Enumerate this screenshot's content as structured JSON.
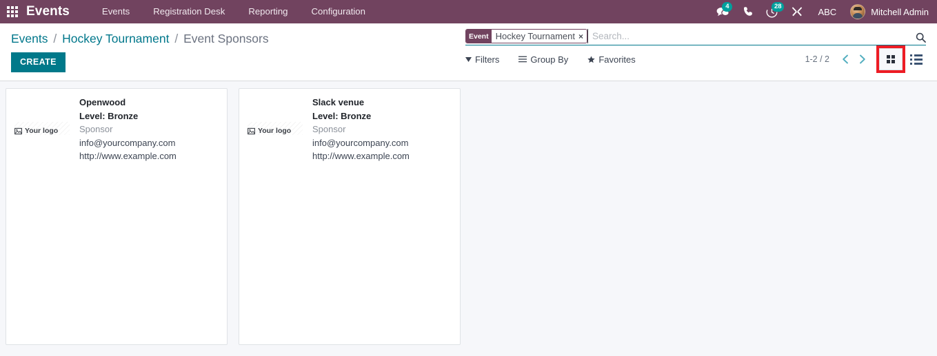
{
  "navbar": {
    "apps_icon": "apps-grid-icon",
    "brand": "Events",
    "menu": [
      {
        "label": "Events"
      },
      {
        "label": "Registration Desk"
      },
      {
        "label": "Reporting"
      },
      {
        "label": "Configuration"
      }
    ],
    "systray": {
      "messages_icon": "chat-bubble-icon",
      "messages_count": "4",
      "phone_icon": "phone-icon",
      "activities_icon": "clock-moon-icon",
      "activities_count": "28",
      "tools_icon": "wrench-icon",
      "debug_label": "ABC",
      "user_name": "Mitchell Admin",
      "avatar_icon": "avatar"
    },
    "colors": {
      "background": "#71435f",
      "badge": "#00a09d"
    }
  },
  "control_panel": {
    "breadcrumb": {
      "root": "Events",
      "parent": "Hockey Tournament",
      "separator": "/",
      "current": "Event Sponsors"
    },
    "create_label": "CREATE",
    "search": {
      "facet_label": "Event",
      "facet_value": "Hockey Tournament",
      "facet_remove_icon": "×",
      "placeholder": "Search...",
      "value": "",
      "magnifier_icon": "search-icon"
    },
    "filters": [
      {
        "label": "Filters",
        "icon": "filter-caret-icon"
      },
      {
        "label": "Group By",
        "icon": "bars-icon"
      },
      {
        "label": "Favorites",
        "icon": "star-icon"
      }
    ],
    "pager": {
      "range": "1-2 / 2",
      "previous_icon": "chevron-left-icon",
      "next_icon": "chevron-right-icon"
    },
    "views": [
      {
        "name": "kanban",
        "icon": "kanban-icon",
        "active": true,
        "highlight_color": "#ed1c24"
      },
      {
        "name": "list",
        "icon": "list-icon",
        "active": false
      }
    ]
  },
  "kanban": {
    "logo_placeholder": "Your logo",
    "logo_icon": "broken-image-icon",
    "cards": [
      {
        "name": "Openwood",
        "level": "Level: Bronze",
        "role": "Sponsor",
        "email": "info@yourcompany.com",
        "website": "http://www.example.com"
      },
      {
        "name": "Slack venue",
        "level": "Level: Bronze",
        "role": "Sponsor",
        "email": "info@yourcompany.com",
        "website": "http://www.example.com"
      }
    ]
  }
}
